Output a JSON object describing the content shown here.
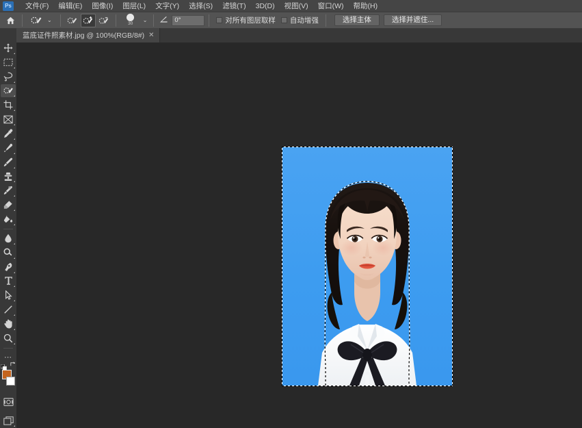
{
  "app": {
    "name": "Adobe Photoshop",
    "logo_text": "Ps",
    "bg_color": "#282828",
    "panel_color": "#383838",
    "options_color": "#535353",
    "menu_color": "#454545"
  },
  "menubar": {
    "items": [
      {
        "label": "文件(F)",
        "name": "menu-file"
      },
      {
        "label": "编辑(E)",
        "name": "menu-edit"
      },
      {
        "label": "图像(I)",
        "name": "menu-image"
      },
      {
        "label": "图层(L)",
        "name": "menu-layer"
      },
      {
        "label": "文字(Y)",
        "name": "menu-type"
      },
      {
        "label": "选择(S)",
        "name": "menu-select"
      },
      {
        "label": "滤镜(T)",
        "name": "menu-filter"
      },
      {
        "label": "3D(D)",
        "name": "menu-3d"
      },
      {
        "label": "视图(V)",
        "name": "menu-view"
      },
      {
        "label": "窗口(W)",
        "name": "menu-window"
      },
      {
        "label": "帮助(H)",
        "name": "menu-help"
      }
    ]
  },
  "options_bar": {
    "home_icon": "home-icon",
    "active_tool_icon": "quick-selection-tool-icon",
    "preset_caret": "⌄",
    "modes": [
      {
        "name": "new-selection-mode",
        "icon": "quick-selection-new-icon",
        "active": false
      },
      {
        "name": "add-to-selection-mode",
        "icon": "quick-selection-add-icon",
        "active": true
      },
      {
        "name": "subtract-from-selection-mode",
        "icon": "quick-selection-subtract-icon",
        "active": false
      }
    ],
    "brush_size": "30",
    "brush_caret": "⌄",
    "angle_icon": "angle-icon",
    "angle_value": "0°",
    "sample_all_layers": {
      "label": "对所有图层取样",
      "checked": false
    },
    "auto_enhance": {
      "label": "自动增强",
      "checked": false
    },
    "select_subject_button": "选择主体",
    "select_and_mask_button": "选择并遮住..."
  },
  "tabbar": {
    "tabs": [
      {
        "title": "蓝底证件照素材.jpg @ 100%(RGB/8#)",
        "filename": "蓝底证件照素材",
        "extension": ".jpg",
        "zoom": "100%",
        "mode": "(RGB/8#)",
        "close_icon": "close-icon",
        "active": true
      }
    ]
  },
  "toolbar": {
    "tools": [
      {
        "name": "move-tool",
        "icon": "move-icon",
        "selected": false
      },
      {
        "name": "rectangular-marquee-tool",
        "icon": "marquee-icon",
        "selected": false
      },
      {
        "name": "lasso-tool",
        "icon": "lasso-icon",
        "selected": false
      },
      {
        "name": "quick-selection-tool",
        "icon": "quick-selection-icon",
        "selected": true
      },
      {
        "name": "crop-tool",
        "icon": "crop-icon",
        "selected": false
      },
      {
        "name": "frame-tool",
        "icon": "frame-icon",
        "selected": false
      },
      {
        "name": "eyedropper-tool",
        "icon": "eyedropper-icon",
        "selected": false
      },
      {
        "name": "spot-healing-brush-tool",
        "icon": "healing-brush-icon",
        "selected": false
      },
      {
        "name": "brush-tool",
        "icon": "brush-icon",
        "selected": false
      },
      {
        "name": "clone-stamp-tool",
        "icon": "clone-stamp-icon",
        "selected": false
      },
      {
        "name": "history-brush-tool",
        "icon": "history-brush-icon",
        "selected": false
      },
      {
        "name": "eraser-tool",
        "icon": "eraser-icon",
        "selected": false
      },
      {
        "name": "gradient-tool",
        "icon": "paint-bucket-icon",
        "selected": false
      },
      {
        "name": "blur-tool",
        "icon": "blur-drop-icon",
        "selected": false
      },
      {
        "name": "dodge-tool",
        "icon": "dodge-icon",
        "selected": false
      },
      {
        "name": "pen-tool",
        "icon": "pen-icon",
        "selected": false
      },
      {
        "name": "type-tool",
        "icon": "type-T-icon",
        "selected": false
      },
      {
        "name": "path-selection-tool",
        "icon": "path-arrow-icon",
        "selected": false
      },
      {
        "name": "line-tool",
        "icon": "line-icon",
        "selected": false
      },
      {
        "name": "hand-tool",
        "icon": "hand-icon",
        "selected": false
      },
      {
        "name": "zoom-tool",
        "icon": "magnifier-icon",
        "selected": false
      },
      {
        "name": "edit-toolbar",
        "icon": "ellipsis-icon",
        "selected": false
      }
    ],
    "colors": {
      "foreground": "#c4641e",
      "background": "#ffffff",
      "default_icon": "default-colors-icon",
      "swap_icon": "swap-colors-icon"
    },
    "quick_mask_icon": "quick-mask-icon",
    "screen_mode_icon": "screen-mode-icon"
  },
  "canvas": {
    "background_color": "#282828",
    "document": {
      "name": "id-photo",
      "photo_background_color": "#3e9ef0",
      "shirt_color": "#ffffff",
      "hair_color": "#171310",
      "skin_color": "#f2d6c4",
      "lip_color": "#e2563f",
      "bowtie_color": "#1b1b22",
      "selection_active": true,
      "selection_label": "marching-ants-selection"
    }
  }
}
